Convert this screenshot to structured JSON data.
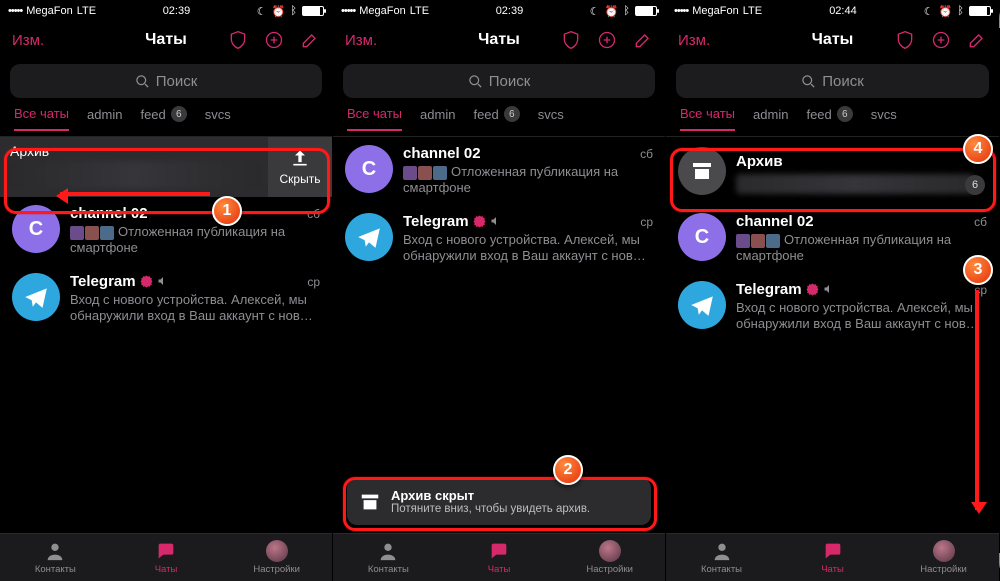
{
  "status": {
    "carrier": "MegaFon",
    "network": "LTE",
    "time1": "02:39",
    "time2": "02:39",
    "time3": "02:44"
  },
  "nav": {
    "edit": "Изм.",
    "title": "Чаты"
  },
  "search": {
    "placeholder": "Поиск"
  },
  "filters": {
    "all": "Все чаты",
    "admin": "admin",
    "feed": "feed",
    "feed_badge": "6",
    "svcs": "svcs"
  },
  "archive": {
    "label": "Архив",
    "hide": "Скрыть",
    "unread": "6"
  },
  "chats": {
    "channel": {
      "name": "channel 02",
      "time": "сб",
      "preview": "Отложенная публикация на смартфоне"
    },
    "telegram": {
      "name": "Telegram",
      "time": "ср",
      "preview": "Вход с нового устройства. Алексей, мы обнаружили вход в Ваш аккаунт с нов…"
    }
  },
  "toast": {
    "title": "Архив скрыт",
    "sub": "Потяните вниз, чтобы увидеть архив."
  },
  "tabs": {
    "contacts": "Контакты",
    "chats": "Чаты",
    "settings": "Настройки"
  },
  "steps": {
    "s1": "1",
    "s2": "2",
    "s3": "3",
    "s4": "4"
  }
}
